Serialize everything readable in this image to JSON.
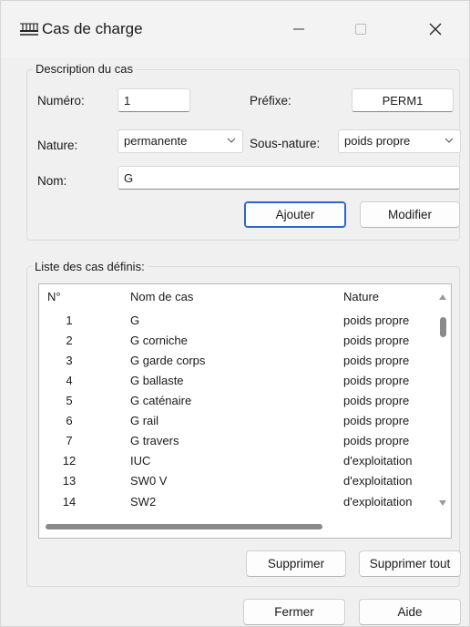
{
  "window": {
    "title": "Cas de charge",
    "app_icon": "load-case-icon",
    "controls": [
      "minimize-icon",
      "maximize-icon",
      "close-icon"
    ]
  },
  "description": {
    "group_label": "Description du cas",
    "numero_label": "Numéro:",
    "numero_value": "1",
    "prefixe_label": "Préfixe:",
    "prefixe_value": "PERM1",
    "nature_label": "Nature:",
    "nature_value": "permanente",
    "sous_nature_label": "Sous-nature:",
    "sous_nature_value": "poids propre",
    "nom_label": "Nom:",
    "nom_value": "G",
    "ajouter_label": "Ajouter",
    "modifier_label": "Modifier"
  },
  "list": {
    "group_label": "Liste des cas définis:",
    "columns": [
      "N°",
      "Nom de cas",
      "Nature"
    ],
    "rows": [
      {
        "num": "1",
        "name": "G",
        "nature": "poids propre"
      },
      {
        "num": "2",
        "name": "G corniche",
        "nature": "poids propre"
      },
      {
        "num": "3",
        "name": "G garde corps",
        "nature": "poids propre"
      },
      {
        "num": "4",
        "name": "G ballaste",
        "nature": "poids propre"
      },
      {
        "num": "5",
        "name": "G caténaire",
        "nature": "poids propre"
      },
      {
        "num": "6",
        "name": "G rail",
        "nature": "poids propre"
      },
      {
        "num": "7",
        "name": "G travers",
        "nature": "poids propre"
      },
      {
        "num": "12",
        "name": "IUC",
        "nature": "d'exploitation"
      },
      {
        "num": "13",
        "name": "SW0 V",
        "nature": "d'exploitation"
      },
      {
        "num": "14",
        "name": "SW2",
        "nature": "d'exploitation"
      }
    ],
    "supprimer_label": "Supprimer",
    "supprimer_tout_label": "Supprimer tout"
  },
  "footer": {
    "fermer_label": "Fermer",
    "aide_label": "Aide"
  },
  "colors": {
    "window_bg": "#f0f0f0",
    "primary_border": "#2b66c7"
  }
}
